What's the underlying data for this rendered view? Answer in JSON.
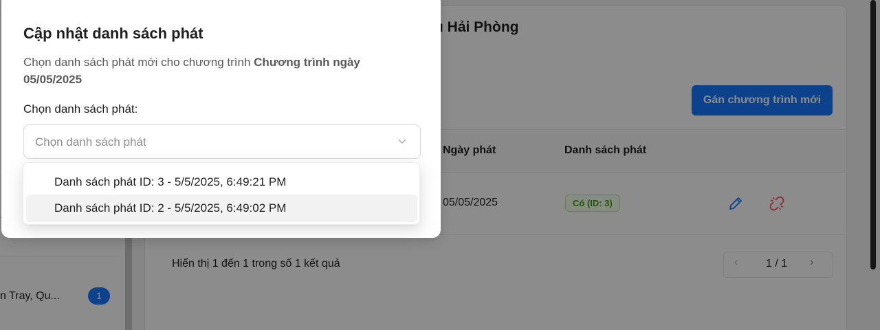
{
  "background": {
    "card_title": "u Hải Phòng",
    "assign_button_label": "Gán chương trình mới",
    "table": {
      "headers": {
        "air_date": "Ngày phát",
        "playlist": "Danh sách phát"
      },
      "row": {
        "air_date": "05/05/2025",
        "playlist_tag": "Có (ID: 3)"
      }
    },
    "summary": "Hiển thị 1 đến 1 trong số 1 kết quả",
    "pagination": {
      "prev": "‹",
      "page_text": "1 / 1",
      "next": "›"
    },
    "sidebar": {
      "store_label": "n Tray, Qu...",
      "store_badge": "1"
    }
  },
  "modal": {
    "title": "Cập nhật danh sách phát",
    "description_prefix": "Chọn danh sách phát mới cho chương trình ",
    "program_name": "Chương trình ngày 05/05/2025",
    "field_label": "Chọn danh sách phát:",
    "select_placeholder": "Chọn danh sách phát",
    "options": [
      {
        "label": "Danh sách phát ID: 3 - 5/5/2025, 6:49:21 PM"
      },
      {
        "label": "Danh sách phát ID: 2 - 5/5/2025, 6:49:02 PM"
      }
    ],
    "active_option_index": 1
  },
  "colors": {
    "primary": "#1677ff",
    "success_text": "#389e0d",
    "danger": "#ff4d4f",
    "overlay": "rgba(0,0,0,0.45)"
  }
}
